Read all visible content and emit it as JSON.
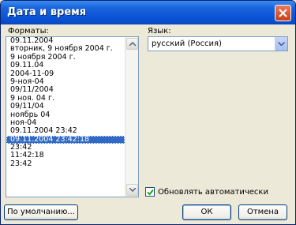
{
  "window": {
    "title": "Дата и время"
  },
  "formats": {
    "label": "Форматы:",
    "items": [
      "09.11.2004",
      "вторник, 9 ноября 2004 г.",
      "9 ноября 2004 г.",
      "09.11.04",
      "2004-11-09",
      "9-ноя-04",
      "09/11/2004",
      "9 ноя. 04 г.",
      "09/11/04",
      "ноябрь 04",
      "ноя-04",
      "09.11.2004 23:42",
      "09.11.2004 23:42:18",
      "23:42",
      "11:42:18",
      "23:42"
    ],
    "selected_index": 12
  },
  "language": {
    "label": "Язык:",
    "value": "русский (Россия)"
  },
  "auto_update": {
    "label": "Обновлять автоматически",
    "checked": true
  },
  "buttons": {
    "default": "По умолчанию...",
    "ok": "ОК",
    "cancel": "Отмена"
  },
  "icons": {
    "close": "close-icon",
    "scroll_up": "scroll-up-icon",
    "scroll_down": "scroll-down-icon",
    "dropdown": "chevron-down-icon",
    "check": "check-icon"
  }
}
